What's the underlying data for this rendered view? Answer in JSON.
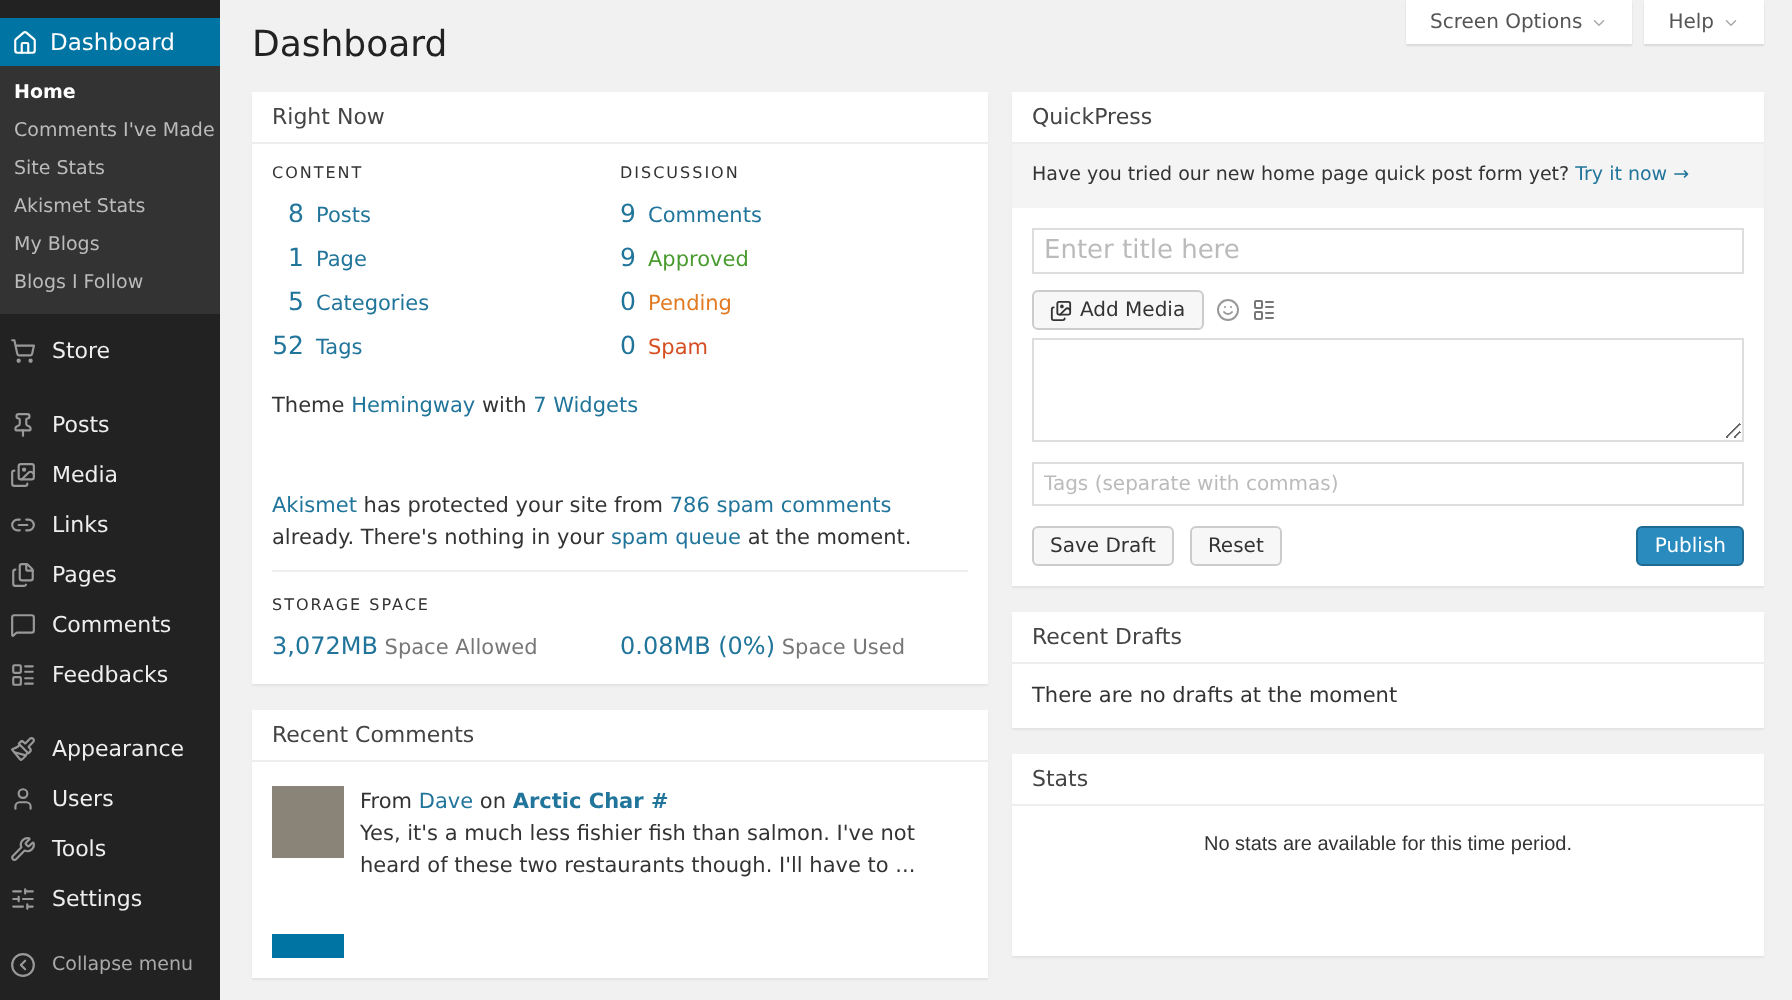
{
  "sidebar": {
    "active": {
      "label": "Dashboard",
      "selected": true,
      "children": [
        {
          "label": "Home",
          "selected": true
        },
        {
          "label": "Comments I've Made",
          "selected": false
        },
        {
          "label": "Site Stats",
          "selected": false
        },
        {
          "label": "Akismet Stats",
          "selected": false
        },
        {
          "label": "My Blogs",
          "selected": false
        },
        {
          "label": "Blogs I Follow",
          "selected": false
        }
      ]
    },
    "groups": [
      [
        {
          "label": "Store"
        }
      ],
      [
        {
          "label": "Posts"
        },
        {
          "label": "Media"
        },
        {
          "label": "Links"
        },
        {
          "label": "Pages"
        },
        {
          "label": "Comments"
        },
        {
          "label": "Feedbacks"
        }
      ],
      [
        {
          "label": "Appearance"
        },
        {
          "label": "Users"
        },
        {
          "label": "Tools"
        },
        {
          "label": "Settings"
        }
      ]
    ],
    "collapse": "Collapse menu"
  },
  "page_title": "Dashboard",
  "top_buttons": [
    "Screen Options",
    "Help"
  ],
  "right_now": {
    "title": "Right Now",
    "content_heading": "CONTENT",
    "discussion_heading": "DISCUSSION",
    "content": [
      {
        "count": "8",
        "label": "Posts"
      },
      {
        "count": "1",
        "label": "Page"
      },
      {
        "count": "5",
        "label": "Categories"
      },
      {
        "count": "52",
        "label": "Tags"
      }
    ],
    "discussion": [
      {
        "count": "9",
        "label": "Comments",
        "kind": "total"
      },
      {
        "count": "9",
        "label": "Approved",
        "kind": "approved"
      },
      {
        "count": "0",
        "label": "Pending",
        "kind": "pending"
      },
      {
        "count": "0",
        "label": "Spam",
        "kind": "spam"
      }
    ],
    "theme": [
      {
        "text": "Theme "
      },
      {
        "text": "Hemingway",
        "link": true
      },
      {
        "text": " with "
      },
      {
        "text": "7 Widgets",
        "link": true
      }
    ],
    "akismet": [
      {
        "text": "Akismet",
        "link": true
      },
      {
        "text": " has protected your site from "
      },
      {
        "text": "786 spam comments",
        "link": true
      },
      {
        "text": " already. There's nothing in your "
      },
      {
        "text": "spam queue",
        "link": true
      },
      {
        "text": " at the moment."
      }
    ],
    "storage_heading": "STORAGE SPACE",
    "storage": [
      {
        "value": "3,072MB",
        "label": "Space Allowed"
      },
      {
        "value": "0.08MB (0%)",
        "label": "Space Used"
      }
    ]
  },
  "recent_comments": {
    "title": "Recent Comments",
    "comments": [
      {
        "from": "From",
        "author": "Dave",
        "on": "on",
        "post": "Arctic Char #",
        "text": "Yes, it's a much less fishier fish than salmon. I've not heard of these two restaurants though. I'll have to ..."
      }
    ]
  },
  "quickpress": {
    "title": "QuickPress",
    "notice": [
      {
        "text": "Have you tried our new home page quick post form yet? "
      },
      {
        "text": "Try it now →",
        "link": true
      }
    ],
    "title_placeholder": "Enter title here",
    "add_media": "Add Media",
    "tags_placeholder": "Tags (separate with commas)",
    "buttons": [
      "Save Draft",
      "Reset"
    ],
    "publish": "Publish"
  },
  "recent_drafts": {
    "title": "Recent Drafts",
    "message": "There are no drafts at the moment"
  },
  "stats": {
    "title": "Stats",
    "message": "No stats are available for this time period."
  }
}
